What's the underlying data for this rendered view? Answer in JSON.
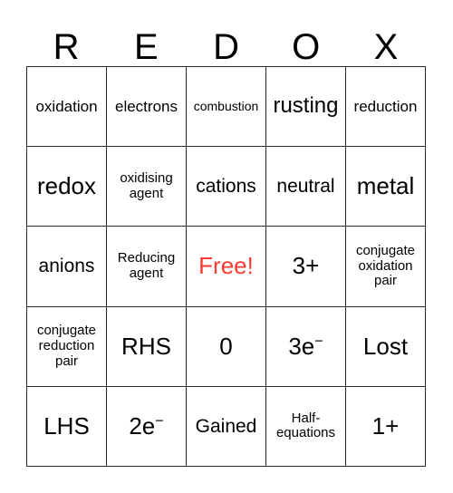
{
  "header": {
    "letters": [
      "R",
      "E",
      "D",
      "O",
      "X"
    ]
  },
  "grid": {
    "rows": 5,
    "columns": 5,
    "free_space_color": "#fa3c32",
    "border_color": "#2b2b2b",
    "background_color": "#ffffff",
    "cells": [
      {
        "text": "oxidation",
        "size": "sm",
        "free": false
      },
      {
        "text": "electrons",
        "size": "sm",
        "free": false
      },
      {
        "text": "combustion",
        "size": "xxs",
        "free": false
      },
      {
        "text": "rusting",
        "size": "lg",
        "free": false
      },
      {
        "text": "reduction",
        "size": "sm",
        "free": false
      },
      {
        "text": "redox",
        "size": "xl",
        "free": false
      },
      {
        "text": "oxidising\nagent",
        "size": "xs",
        "free": false
      },
      {
        "text": "cations",
        "size": "md",
        "free": false
      },
      {
        "text": "neutral",
        "size": "md",
        "free": false
      },
      {
        "text": "metal",
        "size": "xl",
        "free": false
      },
      {
        "text": "anions",
        "size": "md",
        "free": false
      },
      {
        "text": "Reducing\nagent",
        "size": "xs",
        "free": false
      },
      {
        "text": "Free!",
        "size": "xl",
        "free": true
      },
      {
        "text": "3+",
        "size": "xl",
        "free": false
      },
      {
        "text": "conjugate\noxidation\npair",
        "size": "xs",
        "free": false
      },
      {
        "text": "conjugate\nreduction\npair",
        "size": "xs",
        "free": false
      },
      {
        "text": "RHS",
        "size": "xl",
        "free": false
      },
      {
        "text": "0",
        "size": "xl",
        "free": false
      },
      {
        "text": "3e⁻",
        "size": "xl",
        "free": false
      },
      {
        "text": "Lost",
        "size": "xl",
        "free": false
      },
      {
        "text": "LHS",
        "size": "xl",
        "free": false
      },
      {
        "text": "2e⁻",
        "size": "xl",
        "free": false
      },
      {
        "text": "Gained",
        "size": "md",
        "free": false
      },
      {
        "text": "Half-\nequations",
        "size": "xs",
        "free": false
      },
      {
        "text": "1+",
        "size": "xl",
        "free": false
      }
    ]
  }
}
